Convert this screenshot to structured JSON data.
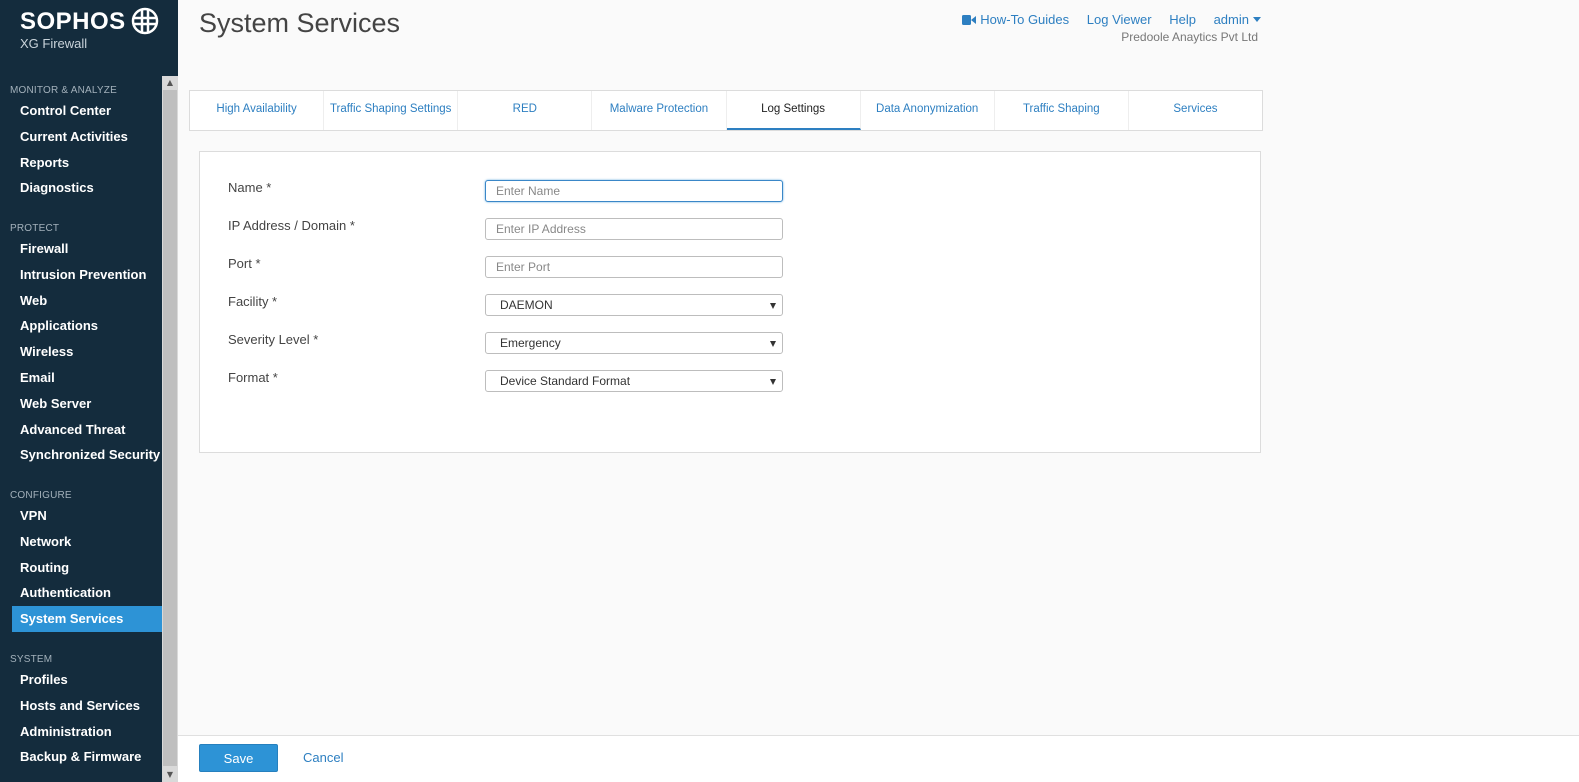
{
  "brand": {
    "name": "SOPHOS",
    "product": "XG Firewall"
  },
  "sidebar": {
    "sections": [
      {
        "title": "MONITOR & ANALYZE",
        "items": [
          "Control Center",
          "Current Activities",
          "Reports",
          "Diagnostics"
        ]
      },
      {
        "title": "PROTECT",
        "items": [
          "Firewall",
          "Intrusion Prevention",
          "Web",
          "Applications",
          "Wireless",
          "Email",
          "Web Server",
          "Advanced Threat",
          "Synchronized Security"
        ]
      },
      {
        "title": "CONFIGURE",
        "items": [
          "VPN",
          "Network",
          "Routing",
          "Authentication",
          "System Services"
        ]
      },
      {
        "title": "SYSTEM",
        "items": [
          "Profiles",
          "Hosts and Services",
          "Administration",
          "Backup & Firmware"
        ]
      }
    ],
    "active_item": "System Services"
  },
  "header": {
    "title": "System Services",
    "links": {
      "how_to": "How-To Guides",
      "log_viewer": "Log Viewer",
      "help": "Help",
      "admin": "admin"
    },
    "company": "Predoole Anaytics Pvt Ltd"
  },
  "tabs": {
    "items": [
      "High Availability",
      "Traffic Shaping Settings",
      "RED",
      "Malware Protection",
      "Log Settings",
      "Data Anonymization",
      "Traffic Shaping",
      "Services"
    ],
    "active": "Log Settings"
  },
  "form": {
    "name": {
      "label": "Name *",
      "value": "",
      "placeholder": "Enter Name"
    },
    "ip": {
      "label": "IP Address / Domain *",
      "value": "",
      "placeholder": "Enter IP Address"
    },
    "port": {
      "label": "Port *",
      "value": "",
      "placeholder": "Enter Port"
    },
    "facility": {
      "label": "Facility *",
      "value": "DAEMON"
    },
    "severity": {
      "label": "Severity Level *",
      "value": "Emergency"
    },
    "format": {
      "label": "Format *",
      "value": "Device Standard Format"
    }
  },
  "footer": {
    "save": "Save",
    "cancel": "Cancel"
  },
  "colors": {
    "sidebar_bg": "#142c3d",
    "accent": "#2d93d6",
    "link": "#2d7fc1"
  }
}
